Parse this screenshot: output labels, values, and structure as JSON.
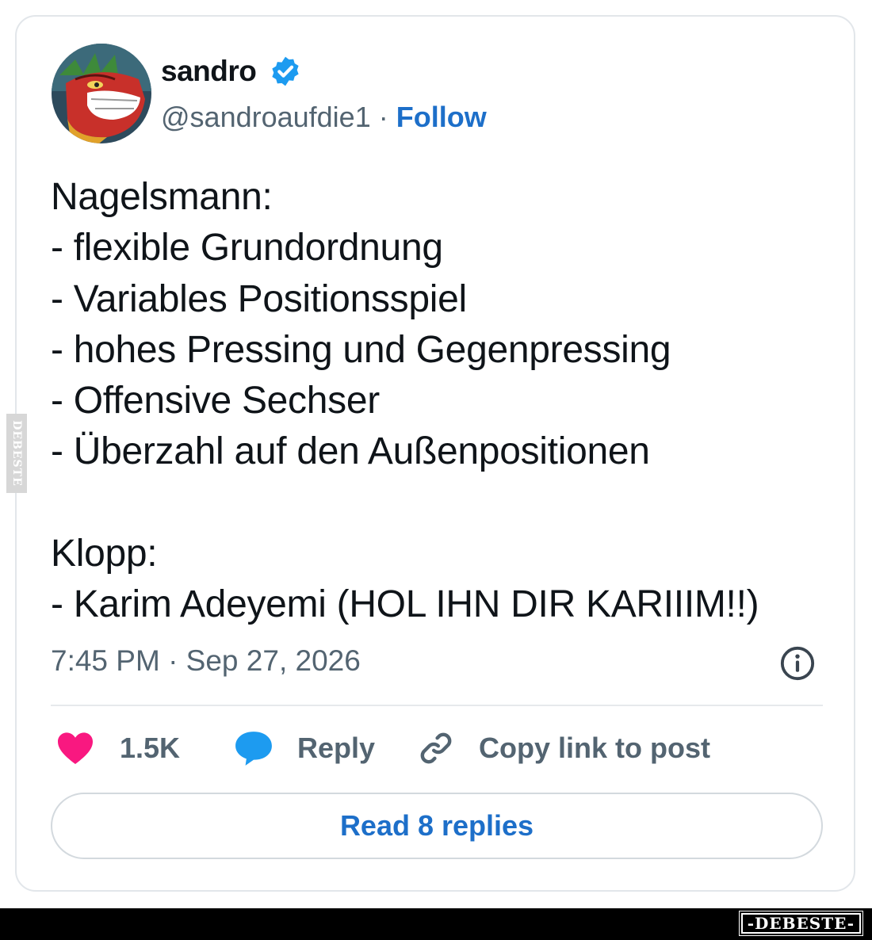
{
  "tweet": {
    "display_name": "sandro",
    "handle": "@sandroaufdie1",
    "separator": " · ",
    "follow_label": "Follow",
    "verified": true,
    "lines": [
      "Nagelsmann:",
      "- flexible Grundordnung",
      "- Variables Positionsspiel",
      "- hohes Pressing und Gegenpressing",
      "- Offensive Sechser",
      "- Überzahl auf den Außenpositionen",
      "",
      "Klopp:",
      "- Karim Adeyemi (HOL IHN DIR KARIIIM!!)"
    ],
    "timestamp": "7:45 PM · Sep 27, 2026"
  },
  "actions": {
    "like_count": "1.5K",
    "reply_label": "Reply",
    "copy_link_label": "Copy link to post"
  },
  "replies_button_label": "Read 8 replies",
  "watermark": {
    "side_text": "DEBESTE",
    "footer_text": "-DEBESTE-"
  },
  "colors": {
    "link": "#1d6fc9",
    "like": "#f91880",
    "reply": "#1d9bf0",
    "verified": "#1d9bf0",
    "secondary_text": "#536471"
  }
}
